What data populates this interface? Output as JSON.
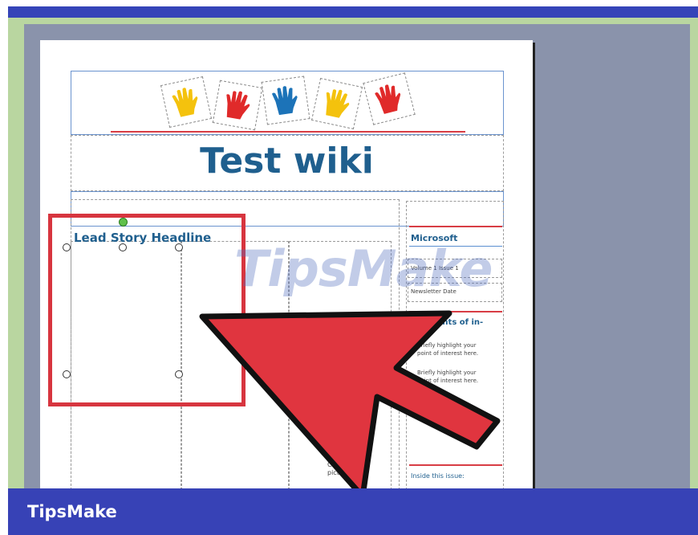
{
  "document": {
    "title": "Test wiki",
    "lead_headline": "Lead Story Headline",
    "sidebar": {
      "org_name": "Microsoft",
      "volume": "Volume 1 Issue 1",
      "newsletter_date": "Newsletter Date",
      "points_heading": "ints of in-",
      "point_1_line1": "Briefly highlight your",
      "point_1_line2": "point of interest here.",
      "point_2_line1": "Briefly highlight your",
      "point_2_line2": "point of interest here.",
      "inside_heading": "Inside this issue:"
    },
    "caption_fragment": "Ca...",
    "caption_fragment_2": "pictu..."
  },
  "watermark": "TipsMake",
  "footer": {
    "brand": "TipsMake"
  },
  "colors": {
    "frame_blue": "#3742b6",
    "title_blue": "#1f5f8e",
    "highlight_red": "#d7353f",
    "workspace_gray": "#8a93ab",
    "frame_green": "#b9d6a0"
  },
  "icons": [
    "hand-print-yellow-icon",
    "hand-print-red-icon",
    "hand-print-blue-icon",
    "hand-print-red-arrow-icon"
  ]
}
